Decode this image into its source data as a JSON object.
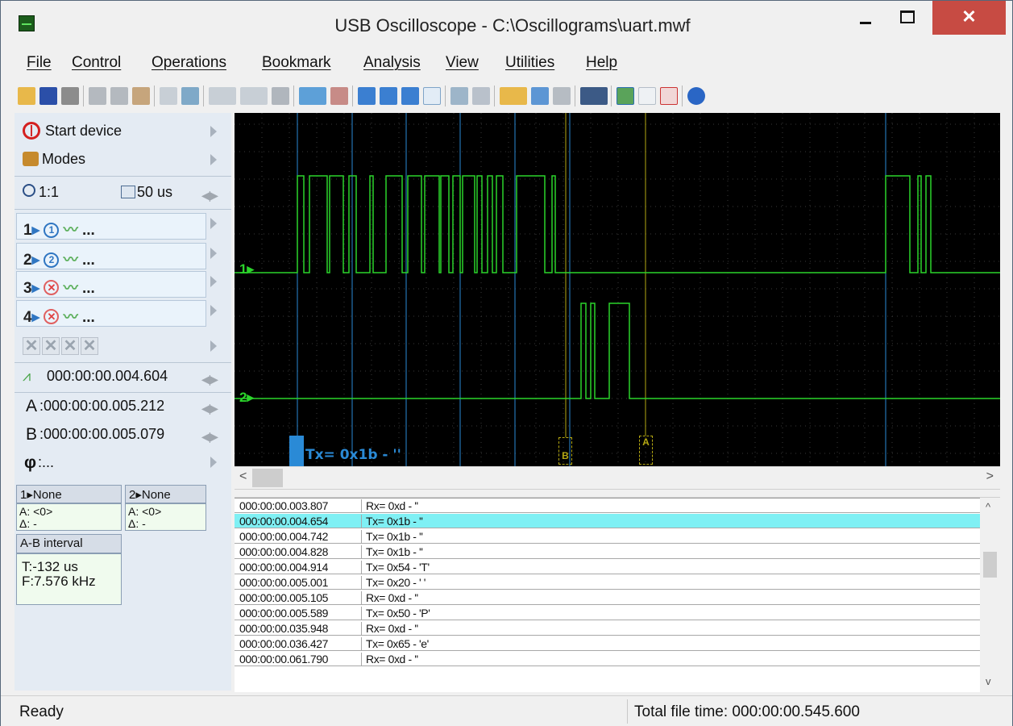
{
  "window": {
    "title": "USB Oscilloscope - C:\\Oscillograms\\uart.mwf",
    "close": "✕"
  },
  "menu": [
    "File",
    "Control",
    "Operations",
    "Bookmark",
    "Analysis",
    "View",
    "Utilities",
    "Help"
  ],
  "left": {
    "start_device": "Start device",
    "modes": "Modes",
    "zoom": "1:1",
    "timebase": "50 us",
    "channels": [
      {
        "label": "1",
        "dots": "..."
      },
      {
        "label": "2",
        "dots": "..."
      },
      {
        "label": "3",
        "dots": "..."
      },
      {
        "label": "4",
        "dots": "..."
      }
    ],
    "trigger_time": "000:00:00.004.604",
    "cursor_a_label": "A",
    "cursor_a": ":000:00:00.005.212",
    "cursor_b_label": "B",
    "cursor_b": ":000:00:00.005.079",
    "phi_label": "φ",
    "phi": ":...",
    "ch1_box": {
      "header": "1▸None",
      "a": "A: <0>",
      "d": "Δ: -"
    },
    "ch2_box": {
      "header": "2▸None",
      "a": "A: <0>",
      "d": "Δ: -"
    },
    "ab": {
      "header": "A-B interval",
      "t": "T:-132 us",
      "f": "F:7.576 kHz"
    }
  },
  "scope": {
    "ch1_marker": "1▸",
    "ch2_marker": "2▸",
    "bookmark_label": "Tx= 0x1b - ''",
    "cursor_a": "A",
    "cursor_b": "B",
    "colors": {
      "trace": "#2bd42b",
      "cursor": "#b5a812",
      "bookmark": "#2a8ad6"
    }
  },
  "decoder_rows": [
    {
      "time": "000:00:00.003.807",
      "value": "Rx= 0xd - ''"
    },
    {
      "time": "000:00:00.004.654",
      "value": "Tx= 0x1b - ''",
      "selected": true
    },
    {
      "time": "000:00:00.004.742",
      "value": "Tx= 0x1b - ''"
    },
    {
      "time": "000:00:00.004.828",
      "value": "Tx= 0x1b - ''"
    },
    {
      "time": "000:00:00.004.914",
      "value": "Tx= 0x54 - 'T'"
    },
    {
      "time": "000:00:00.005.001",
      "value": "Tx= 0x20 - ' '"
    },
    {
      "time": "000:00:00.005.105",
      "value": "Rx= 0xd - ''"
    },
    {
      "time": "000:00:00.005.589",
      "value": "Tx= 0x50 - 'P'"
    },
    {
      "time": "000:00:00.035.948",
      "value": "Rx= 0xd - ''"
    },
    {
      "time": "000:00:00.036.427",
      "value": "Tx= 0x65 - 'e'"
    },
    {
      "time": "000:00:00.061.790",
      "value": "Rx= 0xd - ''"
    }
  ],
  "status": {
    "left": "Ready",
    "right": "Total file time: 000:00:00.545.600"
  }
}
